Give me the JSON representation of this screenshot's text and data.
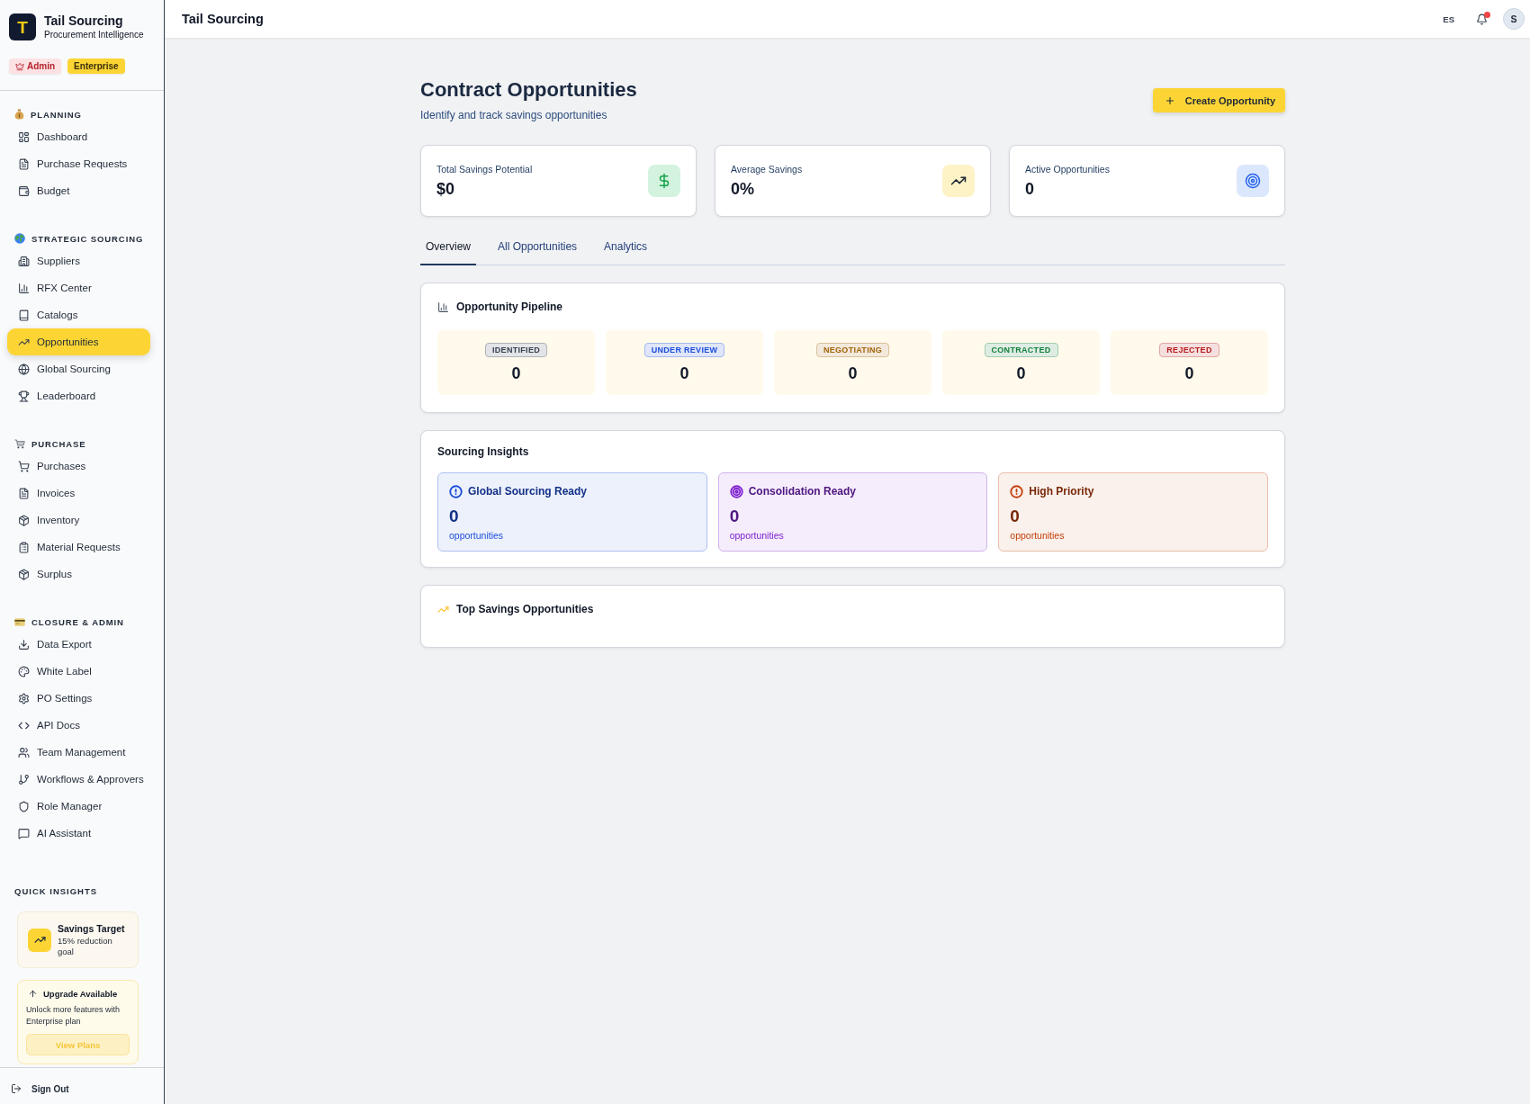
{
  "sidebar": {
    "brand": {
      "logo_text": "T",
      "name": "Tail Sourcing",
      "tagline": "Procurement Intelligence"
    },
    "badges": [
      {
        "label": "Admin",
        "kind": "role"
      },
      {
        "label": "Enterprise",
        "kind": "plan"
      }
    ],
    "sections": [
      {
        "title": "PLANNING",
        "items": [
          {
            "label": "Dashboard",
            "selected": false
          },
          {
            "label": "Purchase Requests",
            "selected": false
          },
          {
            "label": "Budget",
            "selected": false
          }
        ]
      },
      {
        "title": "STRATEGIC SOURCING",
        "items": [
          {
            "label": "Suppliers",
            "selected": false
          },
          {
            "label": "RFX Center",
            "selected": false
          },
          {
            "label": "Catalogs",
            "selected": false
          },
          {
            "label": "Opportunities",
            "selected": true
          },
          {
            "label": "Global Sourcing",
            "selected": false
          },
          {
            "label": "Leaderboard",
            "selected": false
          }
        ]
      },
      {
        "title": "PURCHASE",
        "items": [
          {
            "label": "Purchases",
            "selected": false
          },
          {
            "label": "Invoices",
            "selected": false
          },
          {
            "label": "Inventory",
            "selected": false
          },
          {
            "label": "Material Requests",
            "selected": false
          },
          {
            "label": "Surplus",
            "selected": false
          }
        ]
      },
      {
        "title": "CLOSURE & ADMIN",
        "items": [
          {
            "label": "Data Export",
            "selected": false
          },
          {
            "label": "White Label",
            "selected": false
          },
          {
            "label": "PO Settings",
            "selected": false
          },
          {
            "label": "API Docs",
            "selected": false
          },
          {
            "label": "Team Management",
            "selected": false
          },
          {
            "label": "Workflows & Approvers",
            "selected": false
          },
          {
            "label": "Role Manager",
            "selected": false
          },
          {
            "label": "AI Assistant",
            "selected": false
          }
        ]
      }
    ],
    "quick_insights": {
      "title": "QUICK INSIGHTS",
      "target": {
        "title": "Savings Target",
        "text": "15% reduction goal"
      },
      "upgrade": {
        "title": "Upgrade Available",
        "text": "Unlock more features with Enterprise plan",
        "button": "View Plans"
      }
    },
    "sign_out": "Sign Out"
  },
  "header": {
    "title": "Tail Sourcing",
    "language": "ES",
    "notifications_unread": true,
    "avatar_initial": "S"
  },
  "page": {
    "title": "Contract Opportunities",
    "subtitle": "Identify and track savings opportunities",
    "primary_action": "Create Opportunity"
  },
  "stats": [
    {
      "label": "Total Savings Potential",
      "value": "$0"
    },
    {
      "label": "Average Savings",
      "value": "0%"
    },
    {
      "label": "Active Opportunities",
      "value": "0"
    }
  ],
  "tabs": [
    {
      "label": "Overview",
      "selected": true
    },
    {
      "label": "All Opportunities",
      "selected": false
    },
    {
      "label": "Analytics",
      "selected": false
    }
  ],
  "pipeline": {
    "title": "Opportunity Pipeline",
    "stages": [
      {
        "label": "IDENTIFIED",
        "count": "0",
        "color": "#374151"
      },
      {
        "label": "UNDER REVIEW",
        "count": "0",
        "color": "#1d4ed8"
      },
      {
        "label": "NEGOTIATING",
        "count": "0",
        "color": "#a16207"
      },
      {
        "label": "CONTRACTED",
        "count": "0",
        "color": "#15803d"
      },
      {
        "label": "REJECTED",
        "count": "0",
        "color": "#b91c1c"
      }
    ]
  },
  "insights": {
    "title": "Sourcing Insights",
    "cards": [
      {
        "title": "Global Sourcing Ready",
        "count": "0",
        "unit": "opportunities",
        "color": "#1d4ed8"
      },
      {
        "title": "Consolidation Ready",
        "count": "0",
        "unit": "opportunities",
        "color": "#7e22ce"
      },
      {
        "title": "High Priority",
        "count": "0",
        "unit": "opportunities",
        "color": "#c2410c"
      }
    ]
  },
  "top_savings": {
    "title": "Top Savings Opportunities"
  }
}
